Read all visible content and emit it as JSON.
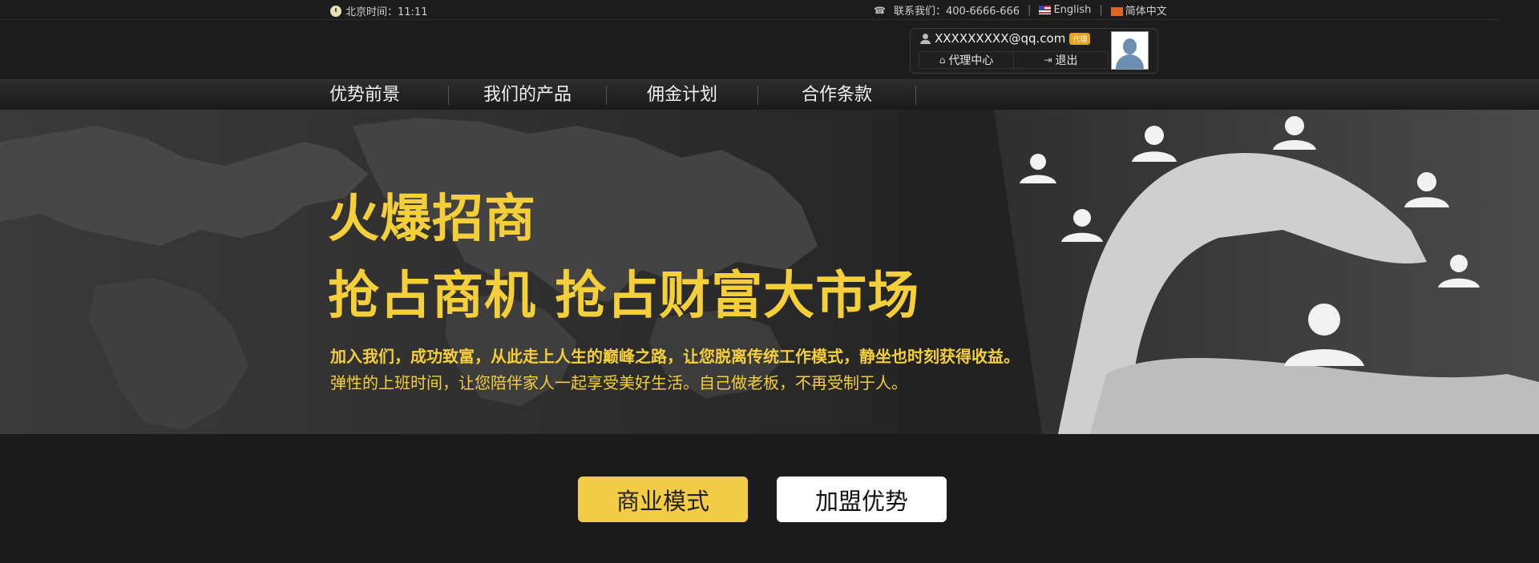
{
  "topbar": {
    "clock_text": "北京时间：11:11",
    "contact": "联系我们：400-6666-666",
    "lang_english": "English",
    "lang_chinese": "简体中文"
  },
  "user": {
    "email": "XXXXXXXXX@qq.com",
    "badge": "代理",
    "agent_center": "代理中心",
    "logout": "退出"
  },
  "nav": {
    "items": [
      "优势前景",
      "我们的产品",
      "佣金计划",
      "合作条款"
    ]
  },
  "hero": {
    "title1": "火爆招商",
    "title2": "抢占商机 抢占财富大市场",
    "text1": "加入我们，成功致富，从此走上人生的巅峰之路，让您脱离传统工作模式，静坐也时刻获得收益。",
    "text2": "弹性的上班时间，让您陪伴家人一起享受美好生活。自己做老板，不再受制于人。"
  },
  "buttons": {
    "business_model": "商业模式",
    "join_advantage": "加盟优势"
  },
  "colors": {
    "accent": "#f4cf3a",
    "background": "#1c1c1c"
  }
}
